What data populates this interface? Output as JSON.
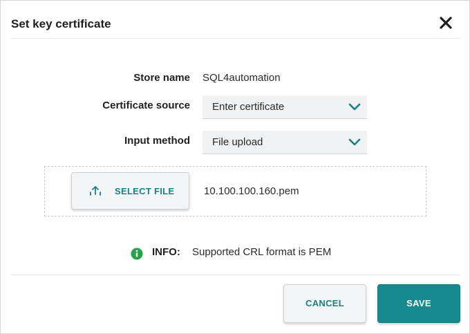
{
  "dialog": {
    "title": "Set key certificate",
    "close_icon": "close-icon"
  },
  "form": {
    "store_name": {
      "label": "Store name",
      "value": "SQL4automation"
    },
    "certificate_source": {
      "label": "Certificate source",
      "selected": "Enter certificate"
    },
    "input_method": {
      "label": "Input method",
      "selected": "File upload"
    }
  },
  "upload": {
    "button_label": "SELECT FILE",
    "button_icon": "upload-icon",
    "file_name": "10.100.100.160.pem"
  },
  "info": {
    "icon": "info-icon",
    "label": "INFO:",
    "text": "Supported CRL format is PEM"
  },
  "footer": {
    "cancel_label": "CANCEL",
    "save_label": "SAVE"
  },
  "colors": {
    "accent": "#178a90",
    "accent_text": "#1b7f87",
    "info_green": "#22a447"
  }
}
